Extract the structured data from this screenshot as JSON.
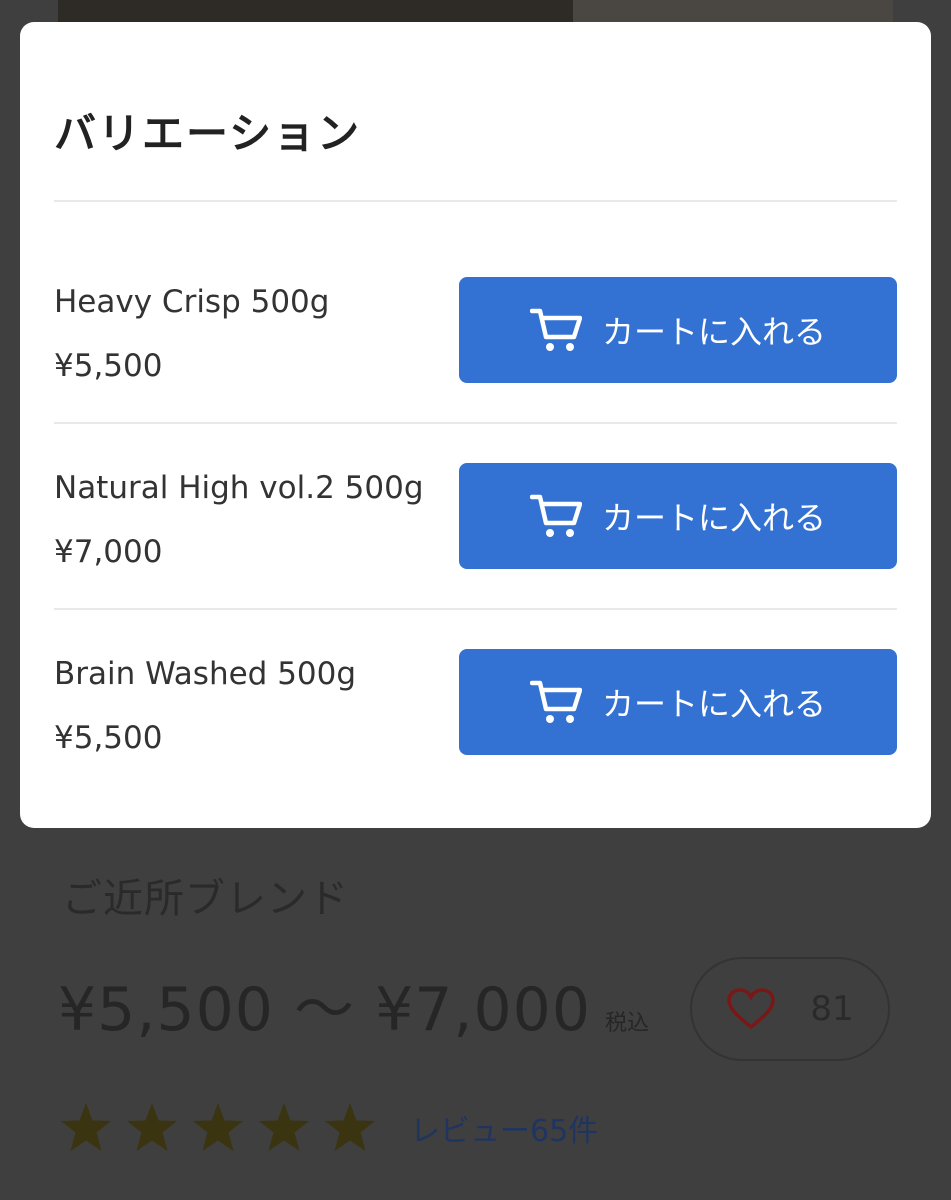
{
  "modal": {
    "title": "バリエーション",
    "variants": [
      {
        "name": "Heavy Crisp 500g",
        "price": "¥5,500",
        "button_label": "カートに入れる"
      },
      {
        "name": "Natural High vol.2 500g",
        "price": "¥7,000",
        "button_label": "カートに入れる"
      },
      {
        "name": "Brain Washed 500g",
        "price": "¥5,500",
        "button_label": "カートに入れる"
      }
    ]
  },
  "product": {
    "name": "ご近所ブレンド",
    "price_range": "¥5,500 〜 ¥7,000",
    "tax_label": "税込",
    "favorite_count": "81",
    "rating": 5,
    "review_link": "レビュー65件"
  },
  "colors": {
    "accent": "#3371d3",
    "overlay": "#3f3f3f",
    "star": "#3a3410",
    "heart": "#8b1a1a"
  },
  "icons": [
    "cart-icon",
    "heart-icon",
    "star-icon"
  ]
}
